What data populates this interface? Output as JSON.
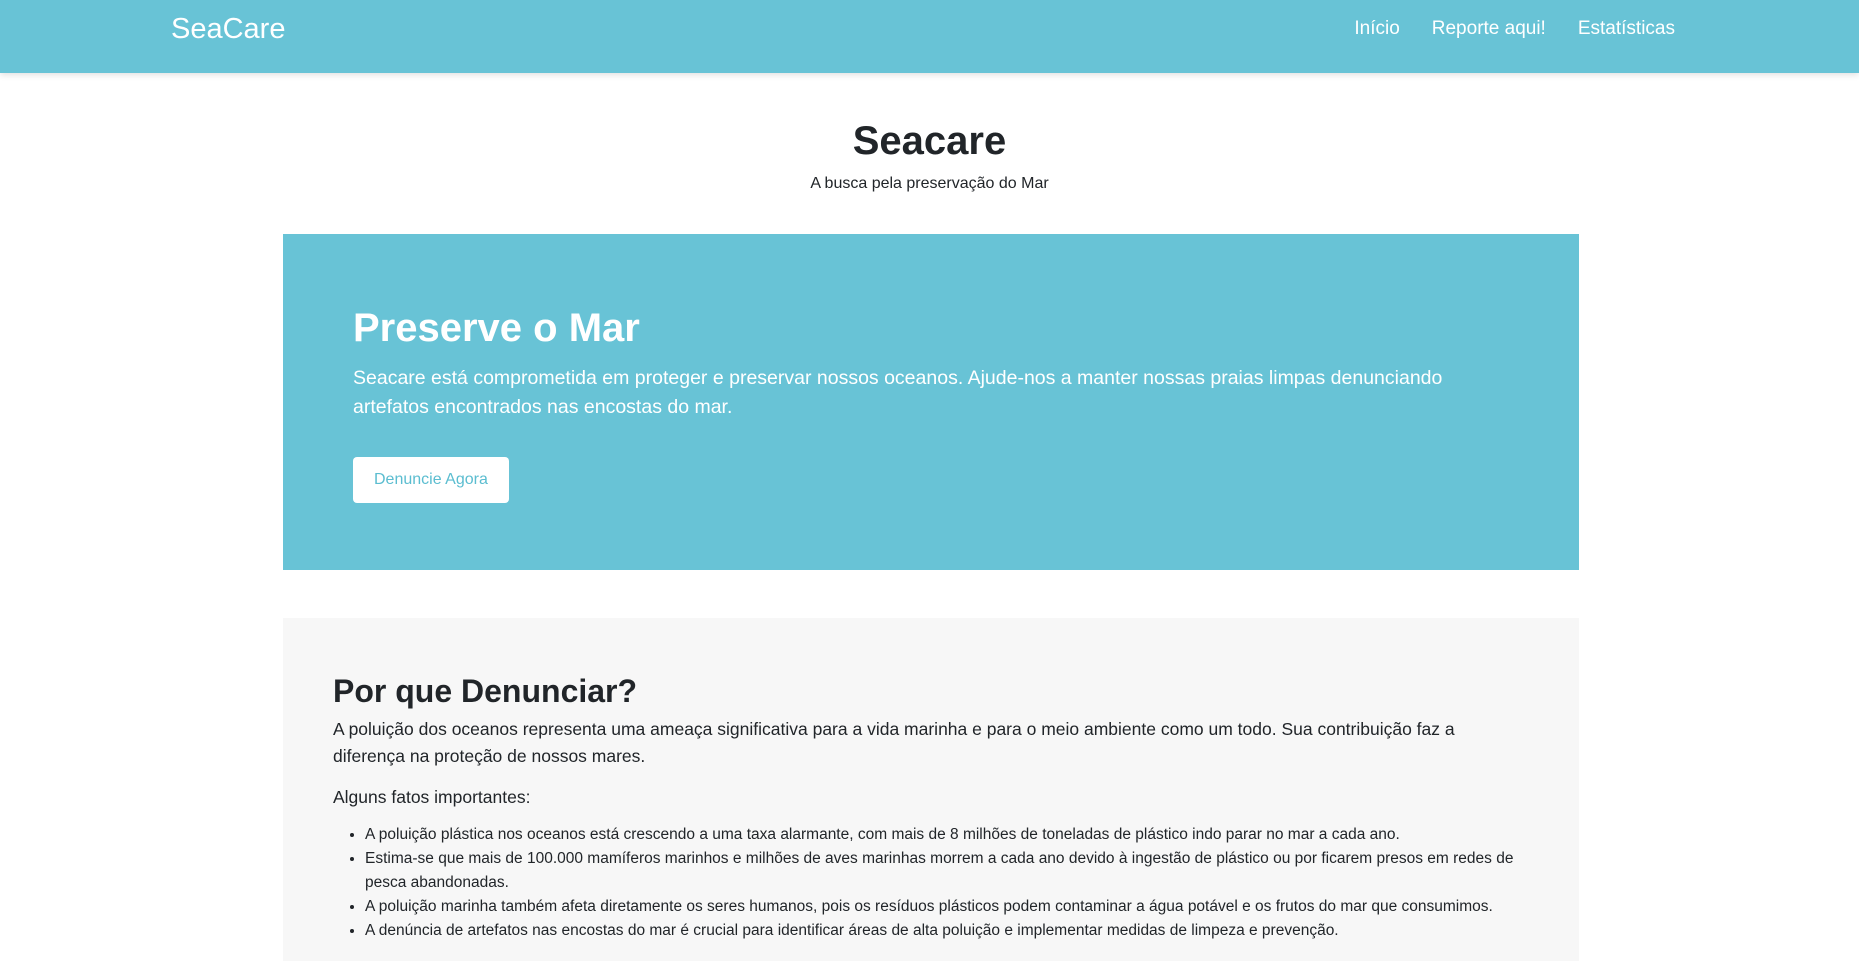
{
  "navbar": {
    "brand": "SeaCare",
    "links": [
      "Início",
      "Reporte aqui!",
      "Estatísticas"
    ]
  },
  "header": {
    "title": "Seacare",
    "subtitle": "A busca pela preservação do Mar"
  },
  "hero": {
    "title": "Preserve o Mar",
    "text": "Seacare está comprometida em proteger e preservar nossos oceanos. Ajude-nos a manter nossas praias limpas denunciando artefatos encontrados nas encostas do mar.",
    "button_label": "Denuncie Agora"
  },
  "why": {
    "title": "Por que Denunciar?",
    "text": "A poluição dos oceanos representa uma ameaça significativa para a vida marinha e para o meio ambiente como um todo. Sua contribuição faz a diferença na proteção de nossos mares.",
    "subhead": "Alguns fatos importantes:",
    "facts": [
      "A poluição plástica nos oceanos está crescendo a uma taxa alarmante, com mais de 8 milhões de toneladas de plástico indo parar no mar a cada ano.",
      "Estima-se que mais de 100.000 mamíferos marinhos e milhões de aves marinhas morrem a cada ano devido à ingestão de plástico ou por ficarem presos em redes de pesca abandonadas.",
      "A poluição marinha também afeta diretamente os seres humanos, pois os resíduos plásticos podem contaminar a água potável e os frutos do mar que consumimos.",
      "A denúncia de artefatos nas encostas do mar é crucial para identificar áreas de alta poluição e implementar medidas de limpeza e prevenção."
    ]
  },
  "colors": {
    "primary": "#68c3d6",
    "section_bg": "#f7f7f7",
    "text": "#212529"
  }
}
